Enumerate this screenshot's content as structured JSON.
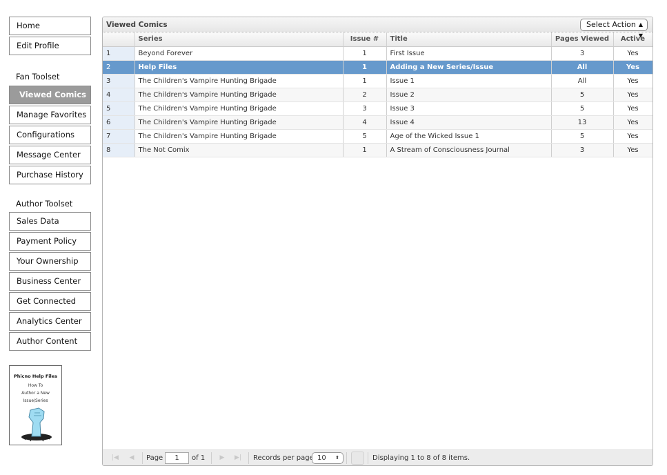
{
  "sidebar": {
    "top_items": [
      {
        "label": "Home"
      },
      {
        "label": "Edit Profile"
      }
    ],
    "fan_section_label": "Fan Toolset",
    "fan_items": [
      {
        "label": "Viewed Comics",
        "active": true
      },
      {
        "label": "Manage Favorites"
      },
      {
        "label": "Configurations"
      },
      {
        "label": "Message Center"
      },
      {
        "label": "Purchase History"
      }
    ],
    "author_section_label": "Author Toolset",
    "author_items": [
      {
        "label": "Sales Data"
      },
      {
        "label": "Payment Policy"
      },
      {
        "label": "Your Ownership"
      },
      {
        "label": "Business Center"
      },
      {
        "label": "Get Connected"
      },
      {
        "label": "Analytics Center"
      },
      {
        "label": "Author Content"
      }
    ],
    "help_card": {
      "title": "Phicno Help Files",
      "line1": "How To",
      "line2": "Author a New",
      "line3": "Issue/Series"
    }
  },
  "grid": {
    "title": "Viewed Comics",
    "action_select": {
      "value": "Select Action"
    },
    "columns": [
      "",
      "Series",
      "Issue #",
      "Title",
      "Pages Viewed",
      "Active"
    ],
    "rows": [
      {
        "n": "1",
        "series": "Beyond Forever",
        "issue": "1",
        "title": "First Issue",
        "pages": "3",
        "active": "Yes"
      },
      {
        "n": "2",
        "series": "Help Files",
        "issue": "1",
        "title": "Adding a New Series/Issue",
        "pages": "All",
        "active": "Yes",
        "selected": true
      },
      {
        "n": "3",
        "series": "The Children's Vampire Hunting Brigade",
        "issue": "1",
        "title": "Issue 1",
        "pages": "All",
        "active": "Yes"
      },
      {
        "n": "4",
        "series": "The Children's Vampire Hunting Brigade",
        "issue": "2",
        "title": "Issue 2",
        "pages": "5",
        "active": "Yes"
      },
      {
        "n": "5",
        "series": "The Children's Vampire Hunting Brigade",
        "issue": "3",
        "title": "Issue 3",
        "pages": "5",
        "active": "Yes"
      },
      {
        "n": "6",
        "series": "The Children's Vampire Hunting Brigade",
        "issue": "4",
        "title": "Issue 4",
        "pages": "13",
        "active": "Yes"
      },
      {
        "n": "7",
        "series": "The Children's Vampire Hunting Brigade",
        "issue": "5",
        "title": "Age of the Wicked Issue 1",
        "pages": "5",
        "active": "Yes"
      },
      {
        "n": "8",
        "series": "The Not Comix",
        "issue": "1",
        "title": "A Stream of Consciousness Journal",
        "pages": "3",
        "active": "Yes"
      }
    ],
    "selected_color": "#6699cc"
  },
  "pager": {
    "page_label": "Page",
    "page_value": "1",
    "of_label": "of 1",
    "records_label": "Records per page:",
    "records_value": "10",
    "status": "Displaying 1 to 8 of 8 items.",
    "icons": {
      "first": "first-page-icon",
      "prev": "prev-page-icon",
      "next": "next-page-icon",
      "last": "last-page-icon",
      "refresh": "refresh-icon"
    }
  }
}
